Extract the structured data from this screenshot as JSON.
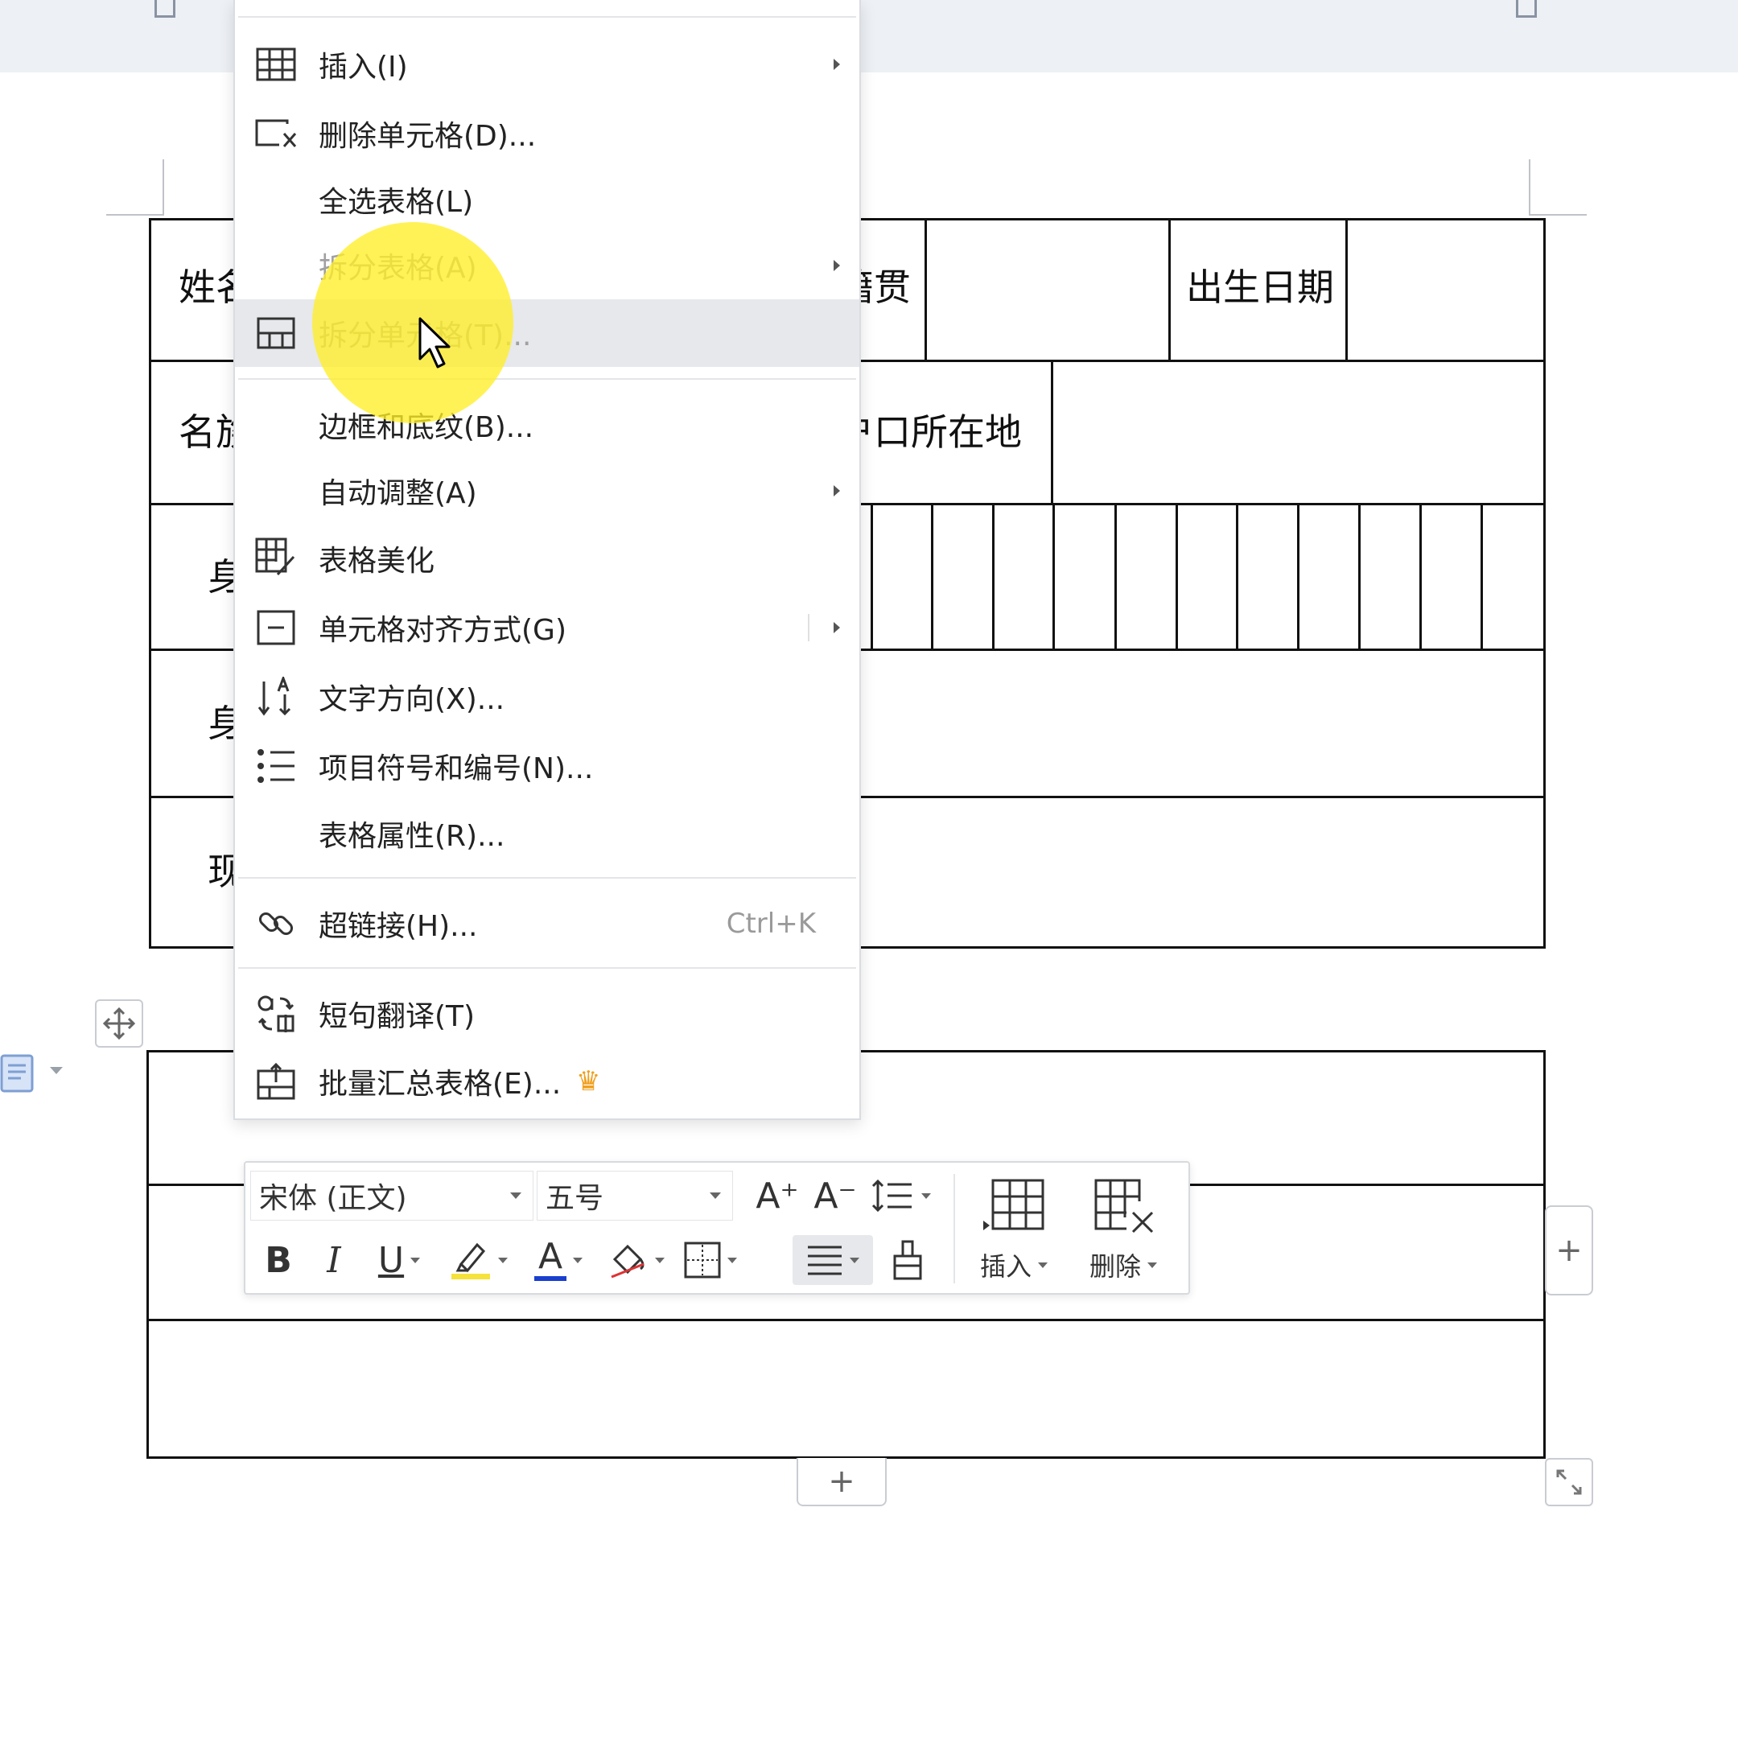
{
  "context_menu": {
    "items": [
      {
        "label": "插入(I)",
        "icon": "table-insert-icon",
        "submenu": true
      },
      {
        "label": "删除单元格(D)...",
        "icon": "delete-cell-icon"
      },
      {
        "label": "全选表格(L)"
      },
      {
        "label": "拆分表格(A)",
        "submenu": true,
        "disabled": true
      },
      {
        "label": "拆分单元格(T)...",
        "icon": "split-cell-icon",
        "disabled": true,
        "hover": true
      },
      {
        "label": "边框和底纹(B)..."
      },
      {
        "label": "自动调整(A)",
        "submenu": true
      },
      {
        "label": "表格美化",
        "icon": "table-beautify-icon"
      },
      {
        "label": "单元格对齐方式(G)",
        "icon": "cell-align-icon",
        "submenu": true
      },
      {
        "label": "文字方向(X)...",
        "icon": "text-direction-icon"
      },
      {
        "label": "项目符号和编号(N)...",
        "icon": "bullets-numbering-icon"
      },
      {
        "label": "表格属性(R)..."
      },
      {
        "label": "超链接(H)...",
        "icon": "hyperlink-icon",
        "shortcut": "Ctrl+K"
      },
      {
        "label": "短句翻译(T)",
        "icon": "translate-icon"
      },
      {
        "label": "批量汇总表格(E)...",
        "icon": "batch-summary-icon",
        "premium": true
      }
    ]
  },
  "table1": {
    "cells": [
      "姓名",
      "籍贯",
      "出生日期",
      "名族",
      "户口所在地",
      "身",
      "身",
      "现"
    ]
  },
  "toolbar": {
    "font_name": "宋体 (正文)",
    "font_size": "五号",
    "bold": "B",
    "italic": "I",
    "underline": "U",
    "font_color_letter": "A",
    "grow_font": "A⁺",
    "shrink_font": "A⁻",
    "insert_label": "插入",
    "delete_label": "删除"
  },
  "widgets": {
    "add_row": "+",
    "add_column": "+"
  },
  "subtitle": "",
  "colors": {
    "highlight": "#ffee28",
    "premium_crown": "#f0a020",
    "font_color_bar": "#1a3fcf",
    "highlighter_bar": "#f5e23a"
  }
}
